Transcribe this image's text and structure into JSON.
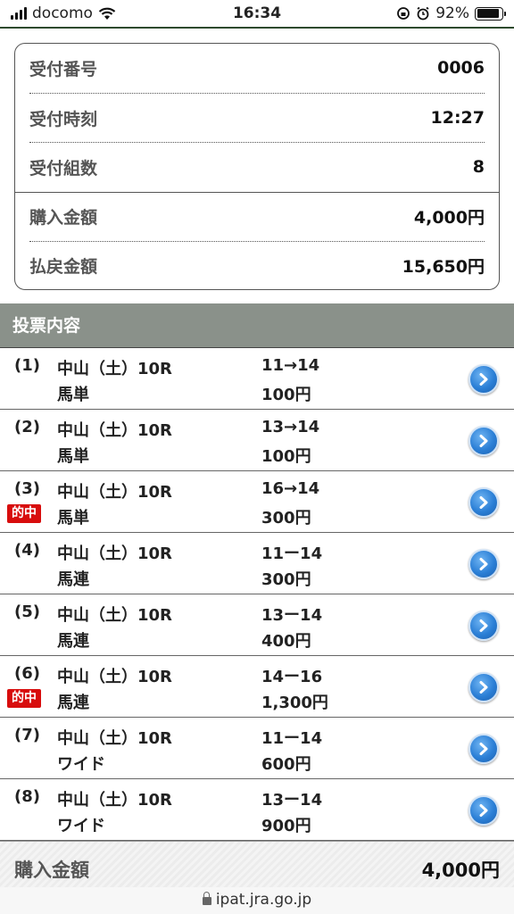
{
  "status_bar": {
    "carrier": "docomo",
    "time": "16:34",
    "battery": "92%",
    "battery_level": 0.92
  },
  "summary": {
    "rows": [
      {
        "label": "受付番号",
        "value": "0006"
      },
      {
        "label": "受付時刻",
        "value": "12:27"
      },
      {
        "label": "受付組数",
        "value": "8"
      },
      {
        "label": "購入金額",
        "value": "4,000円"
      },
      {
        "label": "払戻金額",
        "value": "15,650円"
      }
    ]
  },
  "section": {
    "title": "投票内容"
  },
  "bets": [
    {
      "num": "(1)",
      "race": "中山（土）10R",
      "type": "馬単",
      "combo": "11→14",
      "amount": "100円",
      "hit": ""
    },
    {
      "num": "(2)",
      "race": "中山（土）10R",
      "type": "馬単",
      "combo": "13→14",
      "amount": "100円",
      "hit": ""
    },
    {
      "num": "(3)",
      "race": "中山（土）10R",
      "type": "馬単",
      "combo": "16→14",
      "amount": "300円",
      "hit": "的中"
    },
    {
      "num": "(4)",
      "race": "中山（土）10R",
      "type": "馬連",
      "combo": "11ー14",
      "amount": "300円",
      "hit": ""
    },
    {
      "num": "(5)",
      "race": "中山（土）10R",
      "type": "馬連",
      "combo": "13ー14",
      "amount": "400円",
      "hit": ""
    },
    {
      "num": "(6)",
      "race": "中山（土）10R",
      "type": "馬連",
      "combo": "14ー16",
      "amount": "1,300円",
      "hit": "的中"
    },
    {
      "num": "(7)",
      "race": "中山（土）10R",
      "type": "ワイド",
      "combo": "11ー14",
      "amount": "600円",
      "hit": ""
    },
    {
      "num": "(8)",
      "race": "中山（土）10R",
      "type": "ワイド",
      "combo": "13ー14",
      "amount": "900円",
      "hit": ""
    }
  ],
  "total": {
    "label": "購入金額",
    "value": "4,000円"
  },
  "url": "ipat.jra.go.jp",
  "colors": {
    "hit_badge": "#d80d0d",
    "section_header": "#8a918a",
    "detail_button": "#2b7fd6"
  }
}
